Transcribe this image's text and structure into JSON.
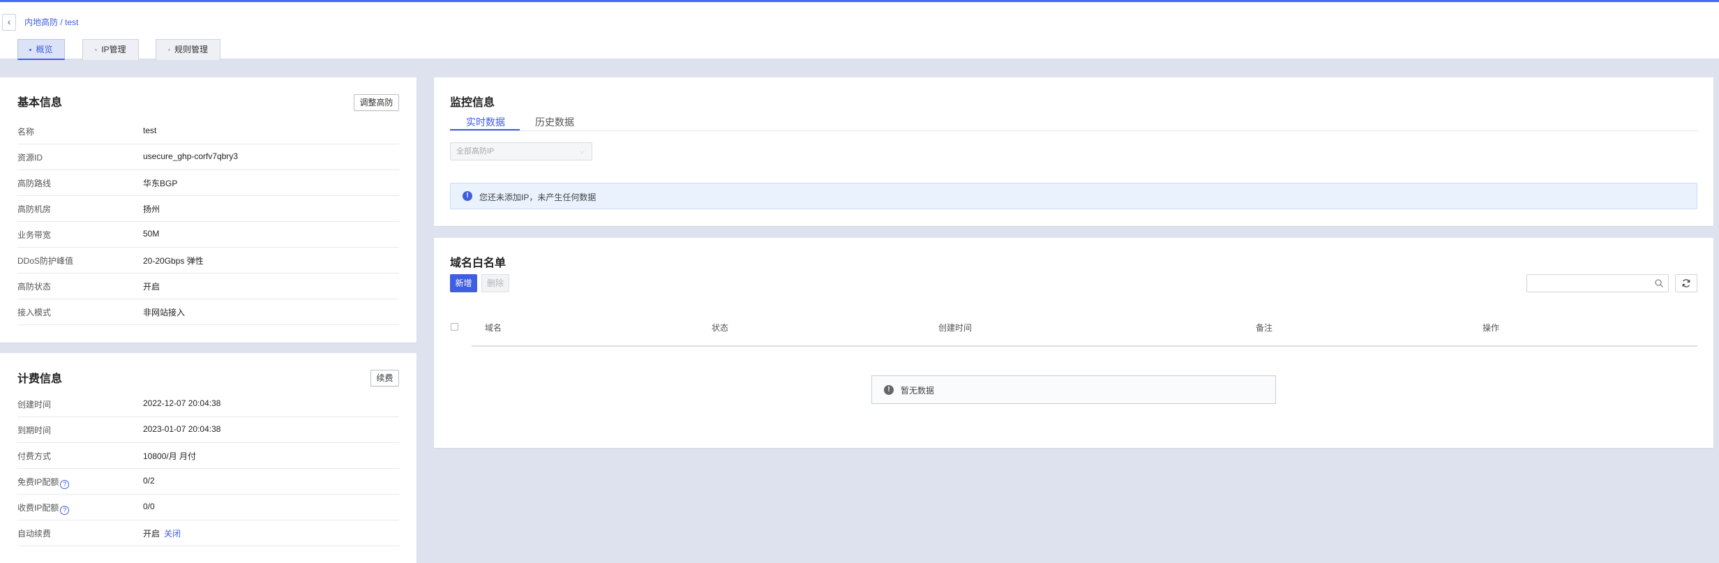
{
  "header": {
    "back_icon": "chevron-left-icon",
    "breadcrumb": "内地高防 / test",
    "tabs": [
      {
        "label": "概览",
        "active": true
      },
      {
        "label": "IP管理",
        "active": false
      },
      {
        "label": "规则管理",
        "active": false
      }
    ]
  },
  "basic_info": {
    "title": "基本信息",
    "adjust_button": "调整高防",
    "rows": [
      {
        "label": "名称",
        "value": "test"
      },
      {
        "label": "资源ID",
        "value": "usecure_ghp-corfv7qbry3"
      },
      {
        "label": "高防路线",
        "value": "华东BGP"
      },
      {
        "label": "高防机房",
        "value": "扬州"
      },
      {
        "label": "业务带宽",
        "value": "50M"
      },
      {
        "label": "DDoS防护峰值",
        "value": "20-20Gbps 弹性"
      },
      {
        "label": "高防状态",
        "value": "开启"
      },
      {
        "label": "接入模式",
        "value": "非网站接入"
      }
    ]
  },
  "billing_info": {
    "title": "计费信息",
    "renew_button": "续费",
    "rows": [
      {
        "label": "创建时间",
        "value": "2022-12-07 20:04:38"
      },
      {
        "label": "到期时间",
        "value": "2023-01-07 20:04:38"
      },
      {
        "label": "付费方式",
        "value": "10800/月 月付"
      },
      {
        "label": "免费IP配额",
        "value": "0/2",
        "help_icon": "?"
      },
      {
        "label": "收费IP配额",
        "value": "0/0",
        "help_icon": "?"
      },
      {
        "label": "自动续费",
        "value": "开启",
        "link": "关闭"
      }
    ]
  },
  "monitor": {
    "title": "监控信息",
    "tabs": [
      {
        "label": "实时数据",
        "active": true
      },
      {
        "label": "历史数据",
        "active": false
      }
    ],
    "select_value": "全部高防IP",
    "notice": "您还未添加IP，未产生任何数据",
    "notice_icon": "!"
  },
  "whitelist": {
    "title": "域名白名单",
    "add_button": "新增",
    "delete_button": "删除",
    "search_placeholder": "",
    "columns": [
      "域名",
      "状态",
      "创建时间",
      "备注",
      "操作"
    ],
    "empty_text": "暂无数据",
    "empty_icon": "!"
  },
  "colors": {
    "accent": "#3f5ee0",
    "page_background": "#dde2ee"
  }
}
